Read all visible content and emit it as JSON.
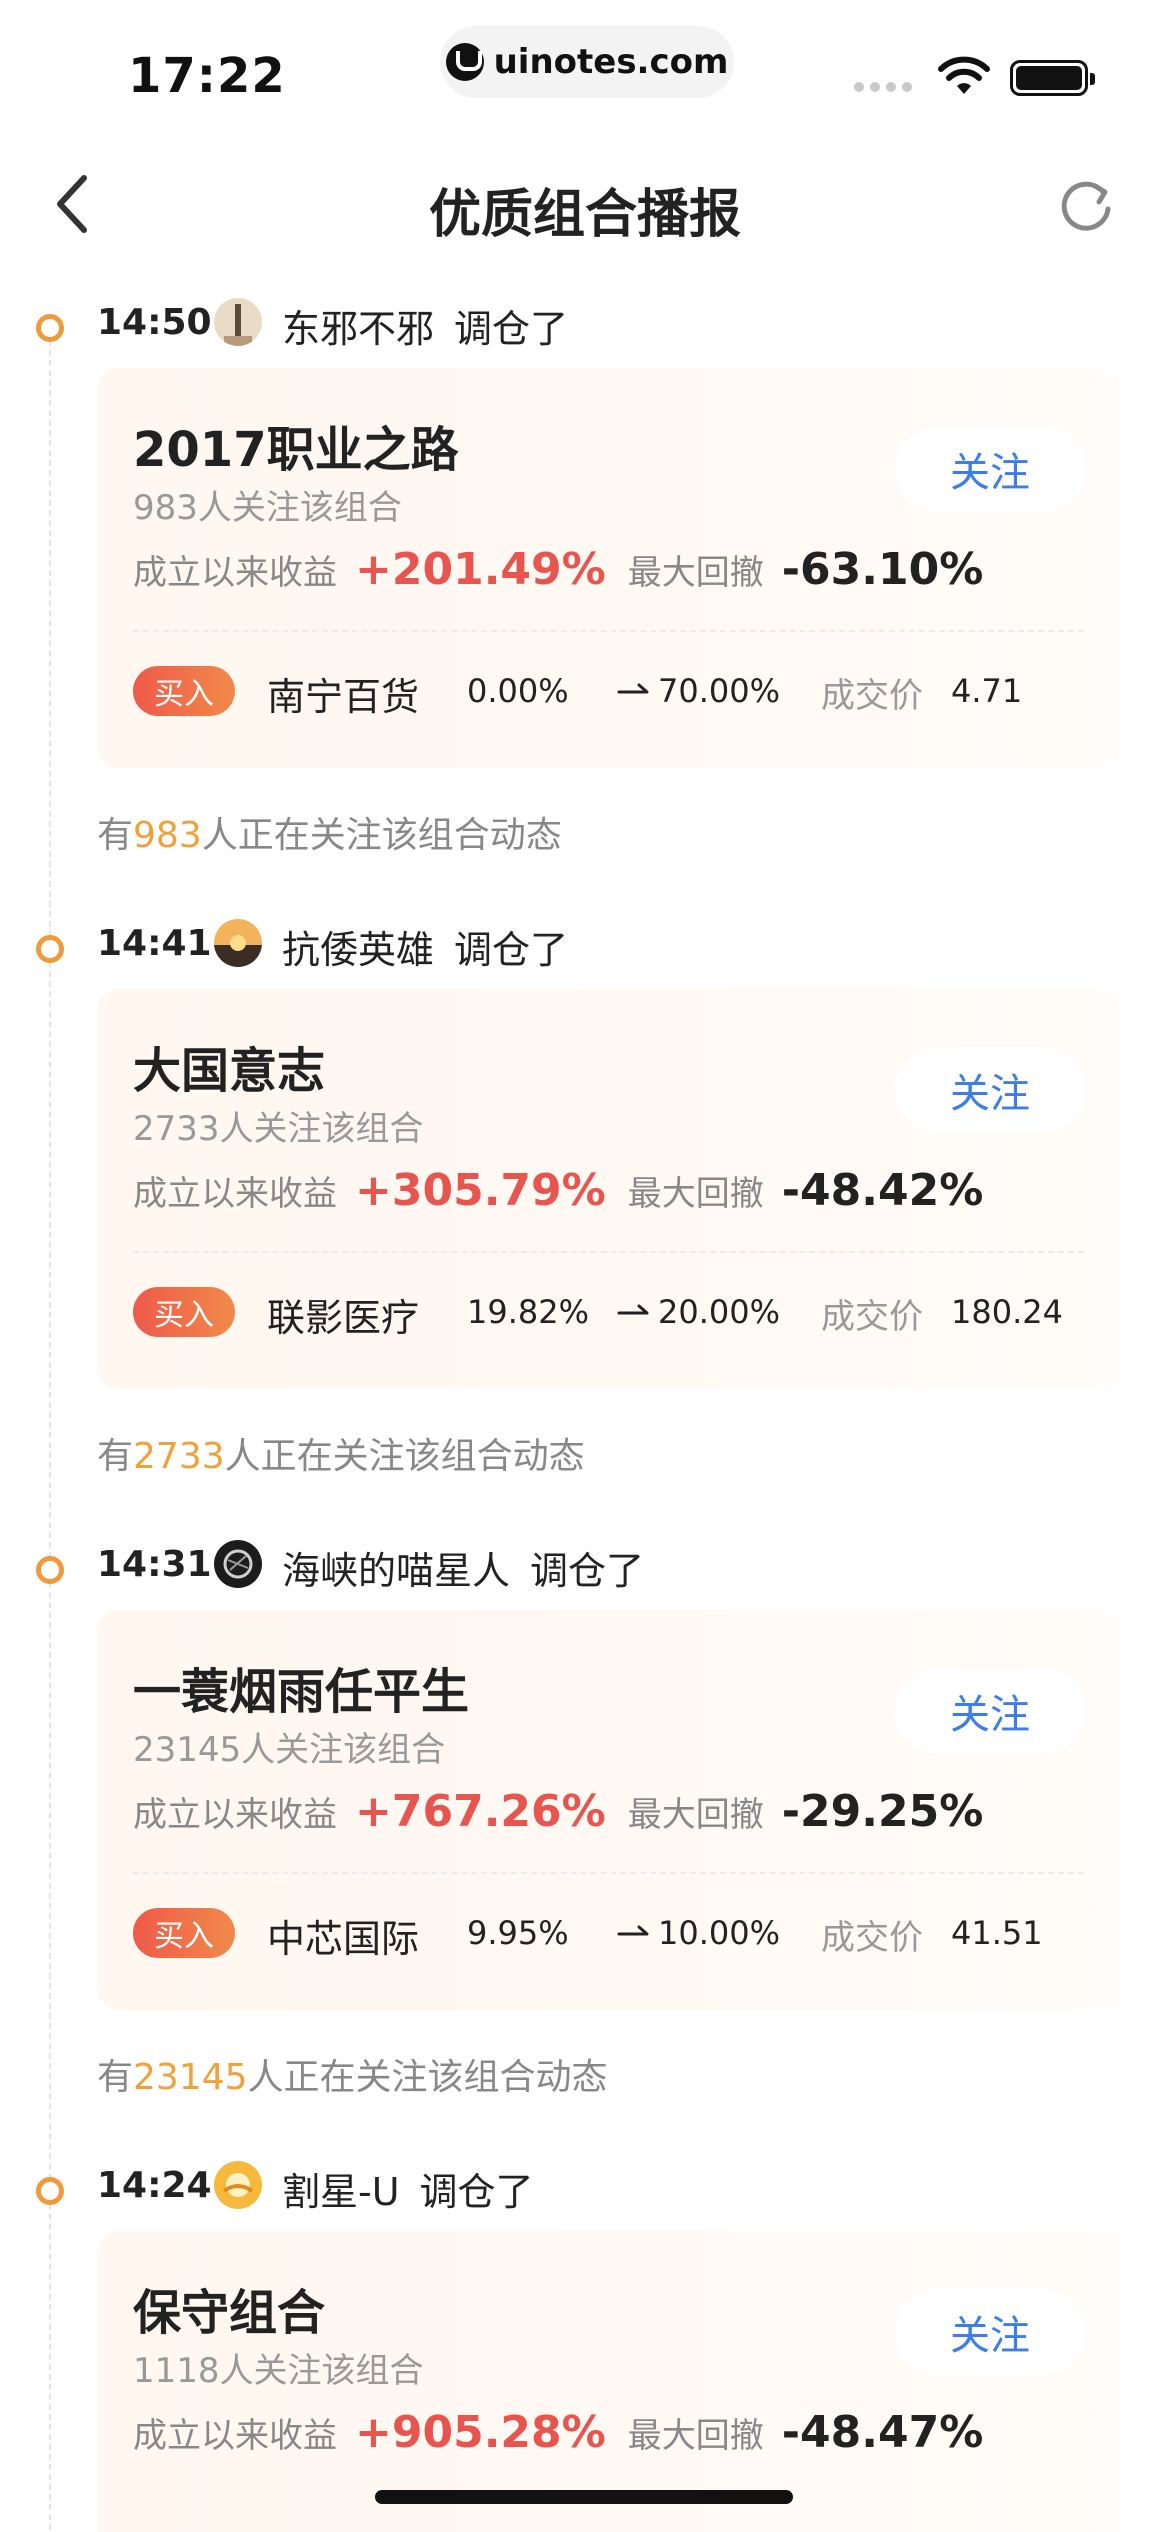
{
  "status_bar": {
    "time": "17:22",
    "url": "uinotes.com"
  },
  "nav": {
    "title": "优质组合播报",
    "back_icon": "chevron-left-icon",
    "refresh_icon": "refresh-icon"
  },
  "labels": {
    "action": "调仓了",
    "follow": "关注",
    "return_label": "成立以来收益",
    "drawdown_label": "最大回撤",
    "price_label": "成交价",
    "watch_prefix": "有",
    "watch_suffix": "人正在关注该组合动态"
  },
  "colors": {
    "accent_blue": "#3b7ee8",
    "return_red": "#e8554e",
    "timeline_orange": "#f19a3b",
    "count_orange": "#f0a23a"
  },
  "feed": [
    {
      "time": "14:50",
      "user": "东邪不邪",
      "portfolio": "2017职业之路",
      "followers_text": "983人关注该组合",
      "return": "+201.49%",
      "drawdown": "-63.10%",
      "trade_type": "买入",
      "stock": "南宁百货",
      "from": "0.00%",
      "to": "70.00%",
      "price": "4.71",
      "watch_count": "983"
    },
    {
      "time": "14:41",
      "user": "抗倭英雄",
      "portfolio": "大国意志",
      "followers_text": "2733人关注该组合",
      "return": "+305.79%",
      "drawdown": "-48.42%",
      "trade_type": "买入",
      "stock": "联影医疗",
      "from": "19.82%",
      "to": "20.00%",
      "price": "180.24",
      "watch_count": "2733"
    },
    {
      "time": "14:31",
      "user": "海峡的喵星人",
      "portfolio": "一蓑烟雨任平生",
      "followers_text": "23145人关注该组合",
      "return": "+767.26%",
      "drawdown": "-29.25%",
      "trade_type": "买入",
      "stock": "中芯国际",
      "from": "9.95%",
      "to": "10.00%",
      "price": "41.51",
      "watch_count": "23145"
    },
    {
      "time": "14:24",
      "user": "割星-U",
      "portfolio": "保守组合",
      "followers_text": "1118人关注该组合",
      "return": "+905.28%",
      "drawdown": "-48.47%"
    }
  ]
}
